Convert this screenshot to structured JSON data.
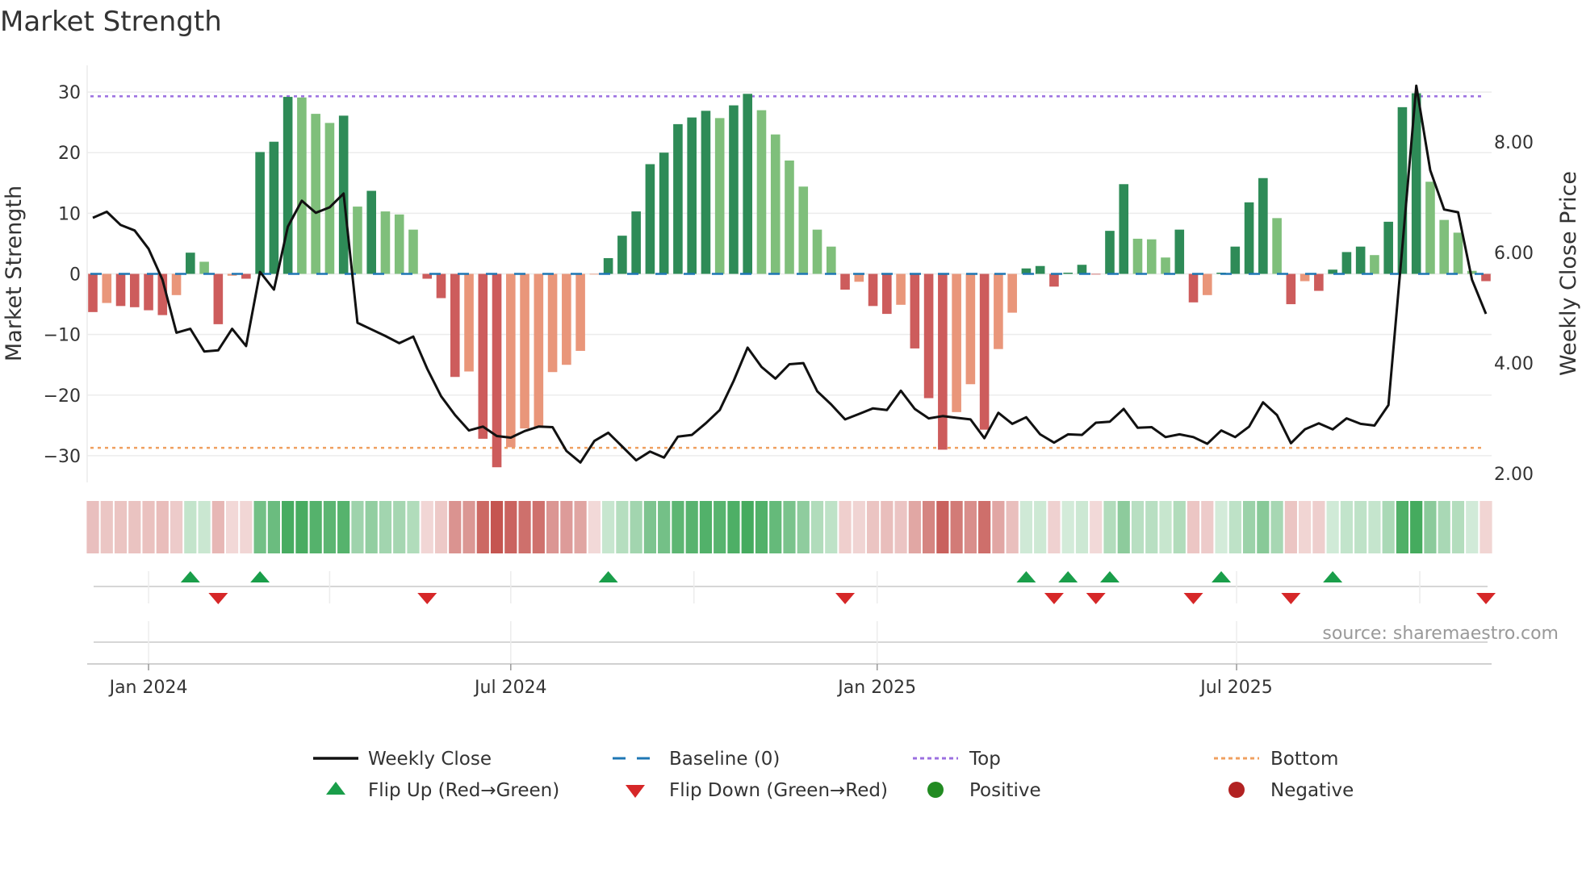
{
  "chart_data": {
    "type": "bar",
    "title": "Market Strength",
    "ylabel": "Market Strength",
    "y2label": "Weekly Close Price",
    "ylim": [
      -34.4,
      34.4
    ],
    "y2lim": [
      1.84,
      9.39
    ],
    "yticks": [
      -30,
      -20,
      -10,
      0,
      10,
      20,
      30
    ],
    "ytick_labels": [
      "−30",
      "−20",
      "−10",
      "0",
      "10",
      "20",
      "30"
    ],
    "y2ticks": [
      2,
      4,
      6,
      8
    ],
    "y2tick_labels": [
      "2.00",
      "4.00",
      "6.00",
      "8.00"
    ],
    "xticks": [
      {
        "week": 4,
        "label": "Jan 2024"
      },
      {
        "week": 30,
        "label": "Jul 2024"
      },
      {
        "week": 56.3,
        "label": "Jan 2025"
      },
      {
        "week": 82.1,
        "label": "Jul 2025"
      }
    ],
    "top_level": 29.3,
    "bottom_level": -28.7,
    "baseline": 0,
    "strength": [
      -6.3,
      -4.8,
      -5.3,
      -5.5,
      -6.0,
      -6.8,
      -3.5,
      3.5,
      2.0,
      -8.3,
      -0.3,
      -0.8,
      20.1,
      21.8,
      29.2,
      29.1,
      26.4,
      24.9,
      26.1,
      11.1,
      13.7,
      10.3,
      9.8,
      7.3,
      -0.8,
      -4.0,
      -17.0,
      -16.1,
      -27.2,
      -31.9,
      -28.6,
      -25.5,
      -25.2,
      -16.2,
      -15.0,
      -12.7,
      -0.1,
      2.6,
      6.3,
      10.3,
      18.1,
      20.0,
      24.7,
      25.8,
      26.9,
      25.7,
      27.8,
      29.7,
      27.0,
      23.0,
      18.7,
      14.4,
      7.3,
      4.5,
      -2.6,
      -1.3,
      -5.3,
      -6.6,
      -5.1,
      -12.3,
      -20.5,
      -29.0,
      -22.8,
      -18.2,
      -25.7,
      -12.4,
      -6.4,
      0.9,
      1.3,
      -2.1,
      0.2,
      1.5,
      -0.1,
      7.1,
      14.8,
      5.8,
      5.7,
      2.7,
      7.3,
      -4.7,
      -3.5,
      0.2,
      4.5,
      11.8,
      15.8,
      9.2,
      -5.0,
      -1.2,
      -2.8,
      0.7,
      3.6,
      4.5,
      3.1,
      8.6,
      27.5,
      29.8,
      15.2,
      8.9,
      6.8,
      0.5,
      -1.2
    ],
    "weekly_close": [
      6.63,
      6.74,
      6.5,
      6.4,
      6.07,
      5.51,
      4.55,
      4.62,
      4.21,
      4.23,
      4.62,
      4.31,
      5.65,
      5.33,
      6.47,
      6.94,
      6.72,
      6.82,
      7.07,
      4.73,
      4.61,
      4.49,
      4.36,
      4.48,
      3.9,
      3.4,
      3.06,
      2.78,
      2.85,
      2.68,
      2.65,
      2.77,
      2.85,
      2.84,
      2.41,
      2.2,
      2.59,
      2.74,
      2.49,
      2.24,
      2.4,
      2.29,
      2.67,
      2.7,
      2.91,
      3.15,
      3.68,
      4.28,
      3.93,
      3.72,
      3.98,
      4.0,
      3.49,
      3.25,
      2.98,
      3.08,
      3.18,
      3.15,
      3.5,
      3.17,
      3.0,
      3.04,
      3.01,
      2.98,
      2.64,
      3.1,
      2.9,
      3.02,
      2.71,
      2.56,
      2.71,
      2.7,
      2.92,
      2.94,
      3.17,
      2.83,
      2.84,
      2.66,
      2.71,
      2.66,
      2.54,
      2.78,
      2.66,
      2.85,
      3.29,
      3.06,
      2.55,
      2.8,
      2.91,
      2.8,
      3.0,
      2.9,
      2.87,
      3.24,
      6.1,
      9.02,
      7.49,
      6.78,
      6.73,
      5.51,
      4.89
    ],
    "flip_up_weeks": [
      7,
      12,
      37,
      67,
      70,
      73,
      81,
      89
    ],
    "flip_down_weeks": [
      9,
      24,
      54,
      69,
      72,
      79,
      86,
      100
    ],
    "legend": {
      "placement": "bottom",
      "entries": [
        {
          "label": "Weekly Close",
          "kind": "line"
        },
        {
          "label": "Baseline (0)",
          "kind": "dash"
        },
        {
          "label": "Top",
          "kind": "dot-purple"
        },
        {
          "label": "Bottom",
          "kind": "dot-orange"
        },
        {
          "label": "Flip Up (Red→Green)",
          "kind": "tri-up"
        },
        {
          "label": "Flip Down (Green→Red)",
          "kind": "tri-down"
        },
        {
          "label": "Positive",
          "kind": "dot-green"
        },
        {
          "label": "Negative",
          "kind": "dot-red"
        }
      ]
    },
    "source": "source: sharemaestro.com",
    "colors": {
      "rising_positive": "#2e8b57",
      "falling_positive": "#7fbf7b",
      "falling_negative": "#cd5c5c",
      "rising_negative": "#e9967a",
      "line": "#111111",
      "baseline": "#1f77b4",
      "top": "#9b6fe0",
      "bottom": "#f0a060",
      "flip_up": "#1a9e4a",
      "flip_down": "#d62728",
      "positive": "#228b22",
      "negative": "#b22222"
    }
  }
}
